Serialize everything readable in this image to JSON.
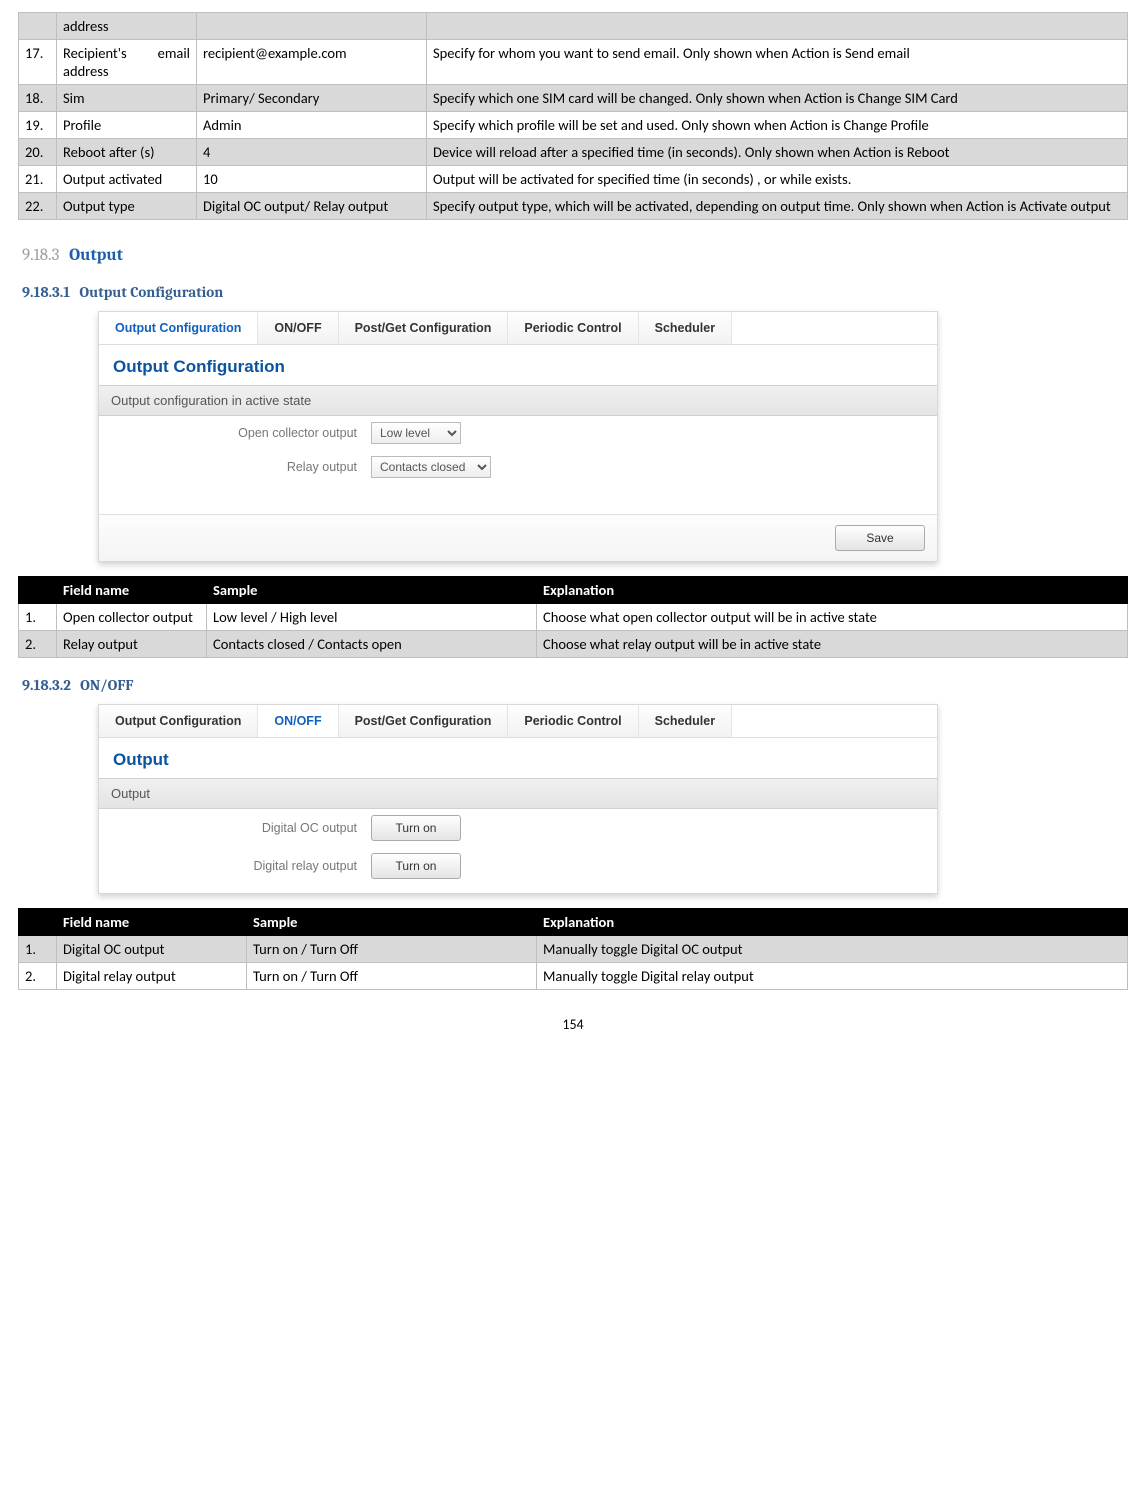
{
  "top_table": {
    "rows": [
      {
        "num": "",
        "field": "address",
        "sample": "",
        "explain": ""
      },
      {
        "num": "17.",
        "field": "Recipient's email address",
        "sample": "recipient@example.com",
        "explain": "Specify for whom you want to send email. Only shown when Action is Send email"
      },
      {
        "num": "18.",
        "field": "Sim",
        "sample": "Primary/ Secondary",
        "explain": "Specify which one SIM card will be changed. Only shown when Action is Change SIM Card"
      },
      {
        "num": "19.",
        "field": "Profile",
        "sample": "Admin",
        "explain": "Specify which profile will be set and used. Only shown when Action is Change Profile"
      },
      {
        "num": "20.",
        "field": "Reboot after (s)",
        "sample": "4",
        "explain": "Device will reload after a specified time (in seconds). Only shown when Action is Reboot"
      },
      {
        "num": "21.",
        "field": "Output activated",
        "sample": "10",
        "explain": "Output will be activated for specified time (in seconds) , or while exists."
      },
      {
        "num": "22.",
        "field": "Output type",
        "sample": "Digital OC output/ Relay output",
        "explain": "Specify output type, which will be activated, depending on output time. Only shown when Action is Activate output"
      }
    ]
  },
  "sections": {
    "s9183": {
      "num": "9.18.3",
      "title": "Output"
    },
    "s91831": {
      "num": "9.18.3.1",
      "title": "Output Configuration"
    },
    "s91832": {
      "num": "9.18.3.2",
      "title": "ON/OFF"
    }
  },
  "ui1": {
    "tabs": [
      "Output Configuration",
      "ON/OFF",
      "Post/Get Configuration",
      "Periodic Control",
      "Scheduler"
    ],
    "active_tab": 0,
    "panel_title": "Output Configuration",
    "subheader": "Output configuration in active state",
    "rows": [
      {
        "label": "Open collector output",
        "value": "Low level"
      },
      {
        "label": "Relay output",
        "value": "Contacts closed"
      }
    ],
    "save_label": "Save"
  },
  "table1": {
    "headers": [
      "",
      "Field name",
      "Sample",
      "Explanation"
    ],
    "rows": [
      {
        "num": "1.",
        "field": "Open collector output",
        "sample": "Low level / High level",
        "explain": "Choose what open collector output will be in active state"
      },
      {
        "num": "2.",
        "field": "Relay output",
        "sample": "Contacts closed / Contacts open",
        "explain": "Choose what relay output will be in active state"
      }
    ]
  },
  "ui2": {
    "tabs": [
      "Output Configuration",
      "ON/OFF",
      "Post/Get Configuration",
      "Periodic Control",
      "Scheduler"
    ],
    "active_tab": 1,
    "panel_title": "Output",
    "subheader": "Output",
    "rows": [
      {
        "label": "Digital OC output",
        "button": "Turn on"
      },
      {
        "label": "Digital relay output",
        "button": "Turn on"
      }
    ]
  },
  "table2": {
    "headers": [
      "",
      "Field name",
      "Sample",
      "Explanation"
    ],
    "rows": [
      {
        "num": "1.",
        "field": "Digital OC output",
        "sample": "Turn on / Turn Off",
        "explain": "Manually toggle Digital OC output"
      },
      {
        "num": "2.",
        "field": "Digital relay output",
        "sample": "Turn on / Turn Off",
        "explain": "Manually toggle Digital relay output"
      }
    ]
  },
  "page_number": "154"
}
